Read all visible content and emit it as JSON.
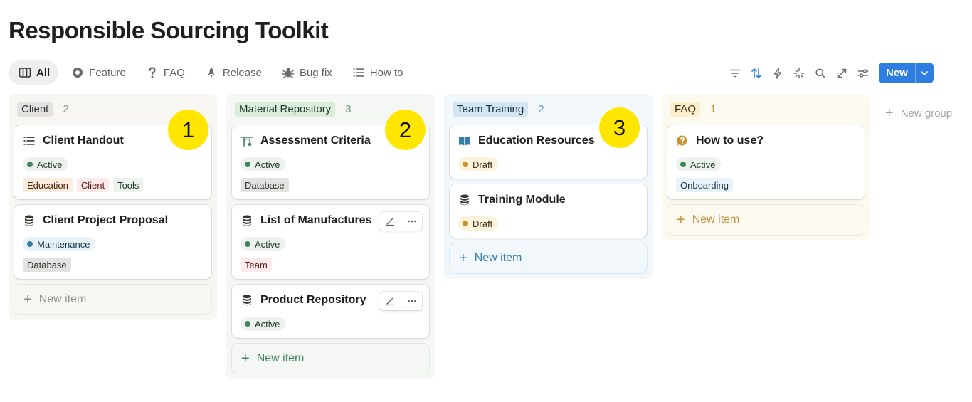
{
  "page": {
    "title": "Responsible Sourcing Toolkit"
  },
  "tabs": [
    {
      "label": "All",
      "icon": "columns-icon"
    },
    {
      "label": "Feature",
      "icon": "circle-icon"
    },
    {
      "label": "FAQ",
      "icon": "question-icon"
    },
    {
      "label": "Release",
      "icon": "rocket-icon"
    },
    {
      "label": "Bug fix",
      "icon": "bug-icon"
    },
    {
      "label": "How to",
      "icon": "list-icon"
    }
  ],
  "toolbar": {
    "new_label": "New",
    "accent": "#2e7de1"
  },
  "columns": [
    {
      "name": "Client",
      "count": "2",
      "badge": "1",
      "cards": [
        {
          "title": "Client Handout",
          "icon": "list-icon",
          "status": "Active",
          "tags": [
            "Education",
            "Client",
            "Tools"
          ]
        },
        {
          "title": "Client Project Proposal",
          "icon": "database-icon",
          "status": "Maintenance",
          "tags": [
            "Database"
          ]
        }
      ],
      "new_item": "New item"
    },
    {
      "name": "Material Repository",
      "count": "3",
      "badge": "2",
      "cards": [
        {
          "title": "Assessment Criteria",
          "icon": "branch-icon",
          "status": "Active",
          "tags": [
            "Database"
          ]
        },
        {
          "title": "List of Manufactures",
          "icon": "database-icon",
          "status": "Active",
          "tags": [
            "Team"
          ]
        },
        {
          "title": "Product Repository",
          "icon": "database-icon",
          "status": "Active",
          "tags": []
        }
      ],
      "new_item": "New item"
    },
    {
      "name": "Team Training",
      "count": "2",
      "badge": "3",
      "cards": [
        {
          "title": "Education Resources",
          "icon": "book-icon",
          "status": "Draft",
          "tags": []
        },
        {
          "title": "Training Module",
          "icon": "database-icon",
          "status": "Draft",
          "tags": []
        }
      ],
      "new_item": "New item"
    },
    {
      "name": "FAQ",
      "count": "1",
      "cards": [
        {
          "title": "How to use?",
          "icon": "question-bubble-icon",
          "status": "Active",
          "tags": [
            "Onboarding"
          ]
        }
      ],
      "new_item": "New item"
    }
  ],
  "new_group": "New group",
  "colors": {
    "status_active": "#448361",
    "status_maintenance": "#337ea9",
    "status_draft": "#cb912f"
  }
}
